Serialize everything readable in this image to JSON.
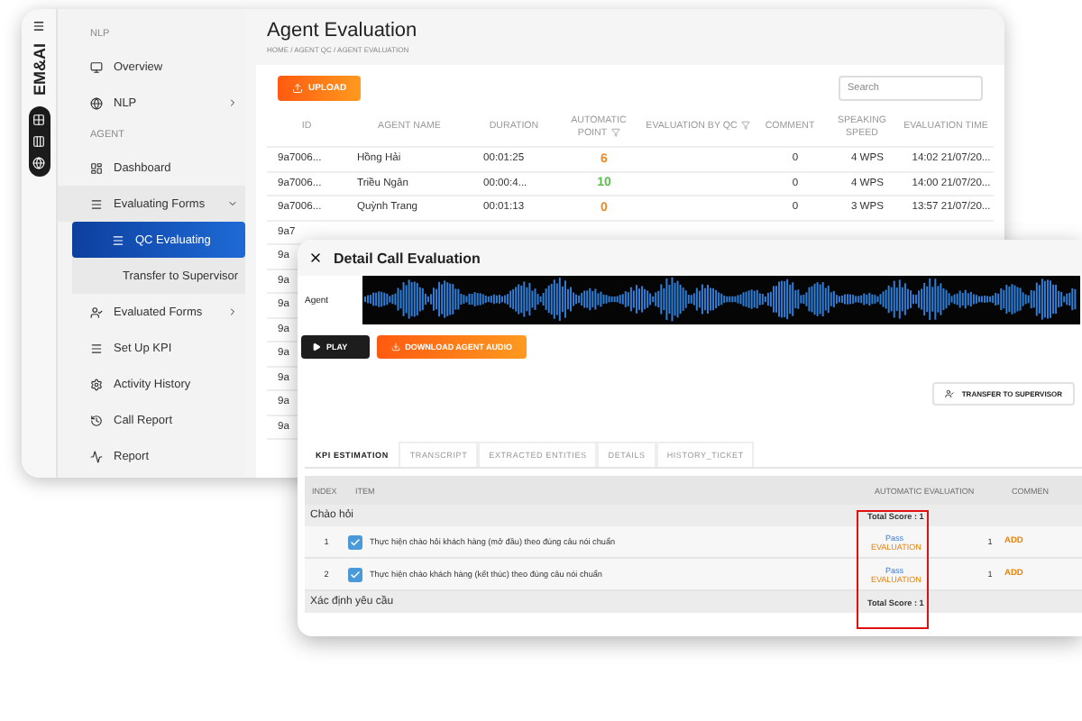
{
  "back_window": {
    "title": "Agent Evaluation",
    "breadcrumb": "HOME / AGENT QC / AGENT EVALUATION",
    "logo": "EM&AI",
    "sidebar": [
      {
        "kind": "header",
        "label": "NLP"
      },
      {
        "kind": "item",
        "label": "Overview",
        "selected": false
      },
      {
        "kind": "item",
        "label": "NLP",
        "selected": false,
        "expanded": false
      },
      {
        "kind": "header",
        "label": "AGENT"
      },
      {
        "kind": "item",
        "label": "Dashboard",
        "selected": false
      },
      {
        "kind": "item",
        "label": "Evaluating Forms",
        "selected": false,
        "expanded": true
      },
      {
        "kind": "sub",
        "label": "QC Evaluating",
        "selected": true
      },
      {
        "kind": "sub",
        "label": "Transfer to Supervisor",
        "selected": false
      },
      {
        "kind": "item",
        "label": "Evaluated Forms",
        "selected": false,
        "expanded": false
      },
      {
        "kind": "item",
        "label": "Set Up KPI",
        "selected": false
      },
      {
        "kind": "item",
        "label": "Activity History",
        "selected": false
      },
      {
        "kind": "item",
        "label": "Call Report",
        "selected": false
      },
      {
        "kind": "item",
        "label": "Report",
        "selected": false
      }
    ],
    "upload_button": "UPLOAD",
    "search": {
      "placeholder": "Search"
    },
    "table": {
      "columns": [
        {
          "label": "ID",
          "filter": false
        },
        {
          "label": "AGENT NAME",
          "filter": false
        },
        {
          "label": "DURATION",
          "filter": false
        },
        {
          "label": "AUTOMATIC POINT",
          "filter": true
        },
        {
          "label": "EVALUATION BY QC",
          "filter": true
        },
        {
          "label": "COMMENT",
          "filter": false
        },
        {
          "label": "SPEAKING SPEED",
          "filter": false
        },
        {
          "label": "EVALUATION TIME",
          "filter": false
        }
      ],
      "rows": [
        {
          "id": "9a7006...",
          "agent": "Hồng Hải",
          "duration": "00:01:25",
          "point": "6",
          "color": "#f0892a",
          "comment": "0",
          "speed": "4 WPS",
          "time": "14:02 21/07/20..."
        },
        {
          "id": "9a7006...",
          "agent": "Triều Ngân",
          "duration": "00:00:4...",
          "point": "10",
          "color": "#5cc04a",
          "comment": "0",
          "speed": "4 WPS",
          "time": "14:00 21/07/20..."
        },
        {
          "id": "9a7006...",
          "agent": "Quỳnh Trang",
          "duration": "00:01:13",
          "point": "0",
          "color": "#f0892a",
          "comment": "0",
          "speed": "3 WPS",
          "time": "13:57 21/07/20..."
        },
        {
          "id": "9a7"
        },
        {
          "id": "9a"
        },
        {
          "id": "9a"
        },
        {
          "id": "9a"
        },
        {
          "id": "9a"
        },
        {
          "id": "9a"
        },
        {
          "id": "9a"
        },
        {
          "id": "9a"
        },
        {
          "id": "9a"
        }
      ]
    }
  },
  "dialog": {
    "title": "Detail Call Evaluation",
    "agent_label": "Agent",
    "play_button": "PLAY",
    "download_button": "DOWNLOAD AGENT AUDIO",
    "transfer_button": "TRANSFER TO SUPERVISOR",
    "tabs": [
      {
        "label": "KPI ESTIMATION",
        "selected": true
      },
      {
        "label": "TRANSCRIPT",
        "selected": false
      },
      {
        "label": "EXTRACTED ENTITIES",
        "selected": false
      },
      {
        "label": "DETAILS",
        "selected": false
      },
      {
        "label": "HISTORY_TICKET",
        "selected": false
      }
    ],
    "columns": [
      "INDEX",
      "ITEM",
      "AUTOMATIC EVALUATION",
      "COMMEN"
    ],
    "rows": [
      {
        "kind": "group",
        "label": "Chào hỏi",
        "score": "Total Score : 1"
      },
      {
        "kind": "item",
        "index": "1",
        "label": "Thực hiện chào hỏi khách hàng (mở đầu) theo đúng câu nói chuẩn",
        "checked": true,
        "result": "Pass",
        "evaluation": "EVALUATION",
        "count": "1",
        "action": "ADD"
      },
      {
        "kind": "item",
        "index": "2",
        "label": "Thực hiện chào khách hàng (kết thúc) theo đúng câu nói chuẩn",
        "checked": true,
        "result": "Pass",
        "evaluation": "EVALUATION",
        "count": "1",
        "action": "ADD"
      },
      {
        "kind": "group",
        "label": "Xác định yêu cầu",
        "score": "Total Score : 1"
      }
    ]
  }
}
